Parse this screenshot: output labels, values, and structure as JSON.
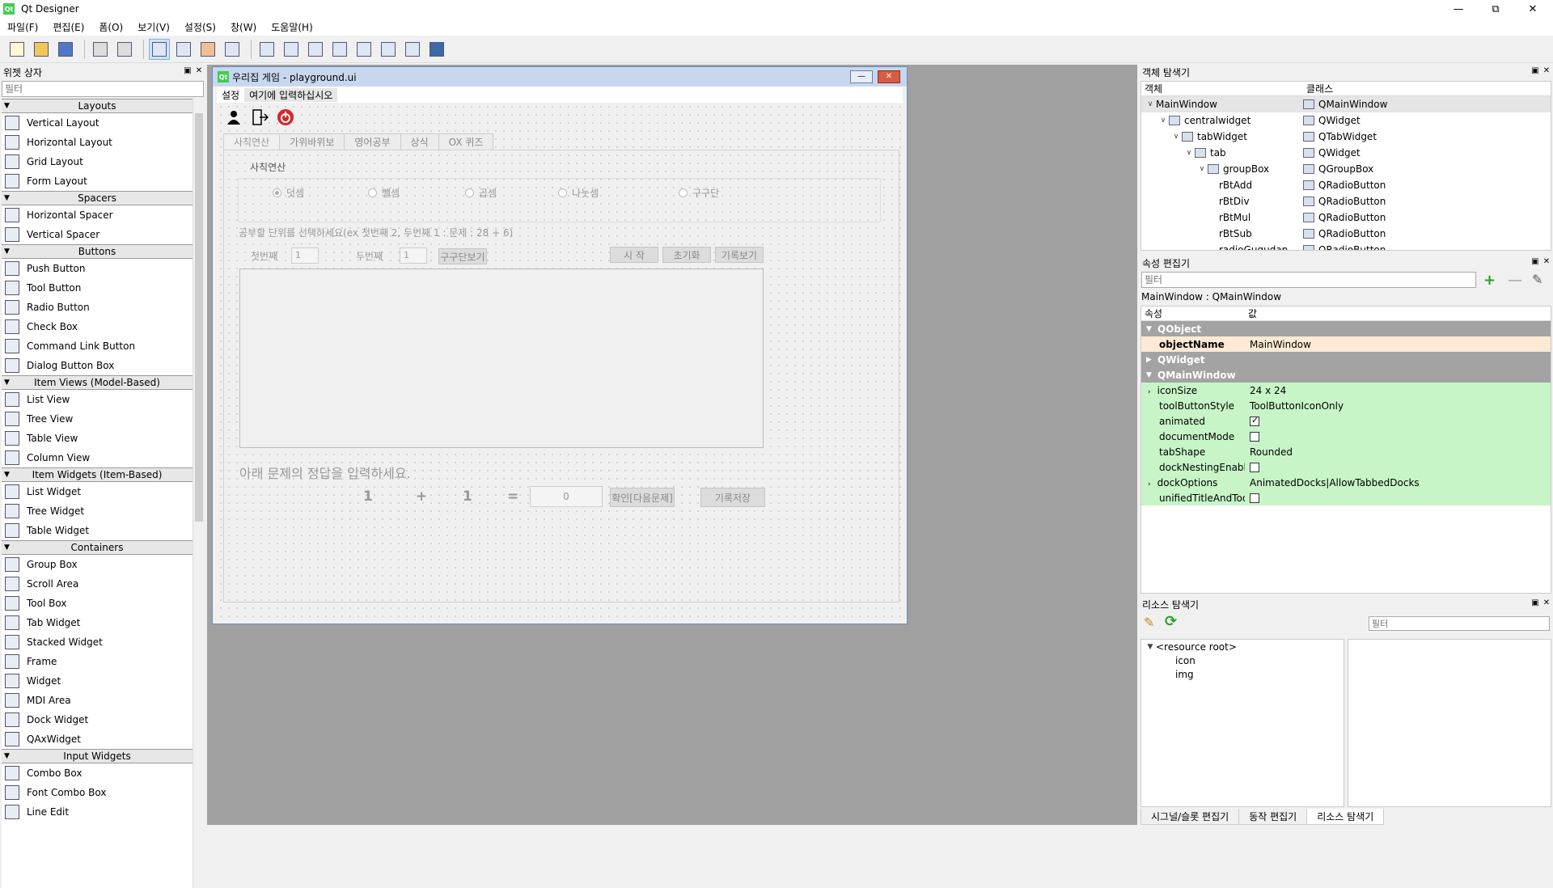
{
  "app": {
    "title": "Qt Designer"
  },
  "menu": [
    "파일(F)",
    "편집(E)",
    "폼(O)",
    "보기(V)",
    "설정(S)",
    "창(W)",
    "도움말(H)"
  ],
  "widget_box": {
    "title": "위젯 상자",
    "filter_placeholder": "필터",
    "categories": [
      {
        "name": "Layouts",
        "items": [
          "Vertical Layout",
          "Horizontal Layout",
          "Grid Layout",
          "Form Layout"
        ]
      },
      {
        "name": "Spacers",
        "items": [
          "Horizontal Spacer",
          "Vertical Spacer"
        ]
      },
      {
        "name": "Buttons",
        "items": [
          "Push Button",
          "Tool Button",
          "Radio Button",
          "Check Box",
          "Command Link Button",
          "Dialog Button Box"
        ]
      },
      {
        "name": "Item Views (Model-Based)",
        "items": [
          "List View",
          "Tree View",
          "Table View",
          "Column View"
        ]
      },
      {
        "name": "Item Widgets (Item-Based)",
        "items": [
          "List Widget",
          "Tree Widget",
          "Table Widget"
        ]
      },
      {
        "name": "Containers",
        "items": [
          "Group Box",
          "Scroll Area",
          "Tool Box",
          "Tab Widget",
          "Stacked Widget",
          "Frame",
          "Widget",
          "MDI Area",
          "Dock Widget",
          "QAxWidget"
        ]
      },
      {
        "name": "Input Widgets",
        "items": [
          "Combo Box",
          "Font Combo Box",
          "Line Edit"
        ]
      }
    ]
  },
  "form": {
    "title": "우리집 게임 - playground.ui",
    "menu": [
      "설정",
      "여기에 입력하십시오"
    ],
    "tabs": [
      "사칙연산",
      "가위바위보",
      "영어공부",
      "상식",
      "OX 퀴즈"
    ],
    "groupbox_title": "사칙연산",
    "radios": [
      "덧셈",
      "뺄셈",
      "곱셈",
      "나눗셈",
      "구구단"
    ],
    "instruction": "공부할 단위를 선택하세요(ex 첫번째 2, 두번째 1 : 문제 : 28 + 6)",
    "first_label": "첫번째",
    "first_value": "1",
    "second_label": "두번째",
    "second_value": "1",
    "gugudan_button": "구구단보기",
    "start_button": "시 작",
    "reset_button": "초기화",
    "history_button": "기록보기",
    "answer_prompt": "아래 문제의 정답을 입력하세요.",
    "operand1": "1",
    "operator": "+",
    "operand2": "1",
    "equals": "=",
    "answer_value": "0",
    "confirm_button": "확인[다음문제]",
    "save_button": "기록저장"
  },
  "object_inspector": {
    "title": "객체 탐색기",
    "col_object": "객체",
    "col_class": "클래스",
    "rows": [
      {
        "name": "MainWindow",
        "cls": "QMainWindow"
      },
      {
        "name": "centralwidget",
        "cls": "QWidget"
      },
      {
        "name": "tabWidget",
        "cls": "QTabWidget"
      },
      {
        "name": "tab",
        "cls": "QWidget"
      },
      {
        "name": "groupBox",
        "cls": "QGroupBox"
      },
      {
        "name": "rBtAdd",
        "cls": "QRadioButton"
      },
      {
        "name": "rBtDiv",
        "cls": "QRadioButton"
      },
      {
        "name": "rBtMul",
        "cls": "QRadioButton"
      },
      {
        "name": "rBtSub",
        "cls": "QRadioButton"
      },
      {
        "name": "radioGugudan",
        "cls": "QRadioButton"
      }
    ]
  },
  "property_editor": {
    "title": "속성 편집기",
    "filter_placeholder": "필터",
    "object_class": "MainWindow : QMainWindow",
    "col_property": "속성",
    "col_value": "값",
    "groups": [
      "QObject",
      "QWidget",
      "QMainWindow"
    ],
    "object_name": {
      "name": "objectName",
      "value": "MainWindow"
    },
    "props": [
      {
        "name": "iconSize",
        "value": "24 x 24"
      },
      {
        "name": "toolButtonStyle",
        "value": "ToolButtonIconOnly"
      },
      {
        "name": "animated",
        "value": ""
      },
      {
        "name": "documentMode",
        "value": ""
      },
      {
        "name": "tabShape",
        "value": "Rounded"
      },
      {
        "name": "dockNestingEnabled",
        "value": ""
      },
      {
        "name": "dockOptions",
        "value": "AnimatedDocks|AllowTabbedDocks"
      },
      {
        "name": "unifiedTitleAndToolB...",
        "value": ""
      }
    ]
  },
  "resource_browser": {
    "title": "리소스 탐색기",
    "filter_placeholder": "필터",
    "root": "<resource root>",
    "children": [
      "icon",
      "img"
    ]
  },
  "bottom_tabs": [
    "시그널/슬롯 편집기",
    "동작 편집기",
    "리소스 탐색기"
  ]
}
